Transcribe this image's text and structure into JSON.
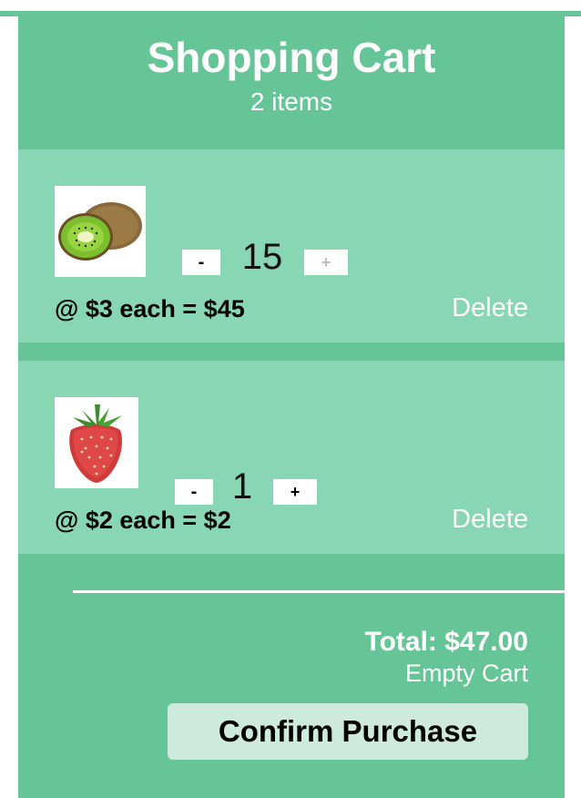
{
  "header": {
    "title": "Shopping Cart",
    "item_count": "2 items"
  },
  "items": [
    {
      "name": "kiwi",
      "image_icon": "kiwi-icon",
      "minus_label": "-",
      "quantity": "15",
      "plus_label": "+",
      "price_line": "@ $3 each = $45",
      "delete_label": "Delete"
    },
    {
      "name": "strawberry",
      "image_icon": "strawberry-icon",
      "minus_label": "-",
      "quantity": "1",
      "plus_label": "+",
      "price_line": "@ $2 each = $2",
      "delete_label": "Delete"
    }
  ],
  "footer": {
    "total": "Total: $47.00",
    "empty_cart": "Empty Cart",
    "confirm": "Confirm Purchase"
  },
  "colors": {
    "panel": "#65c596",
    "item_bg": "#89d6b4",
    "confirm_bg": "#cdeadc"
  }
}
